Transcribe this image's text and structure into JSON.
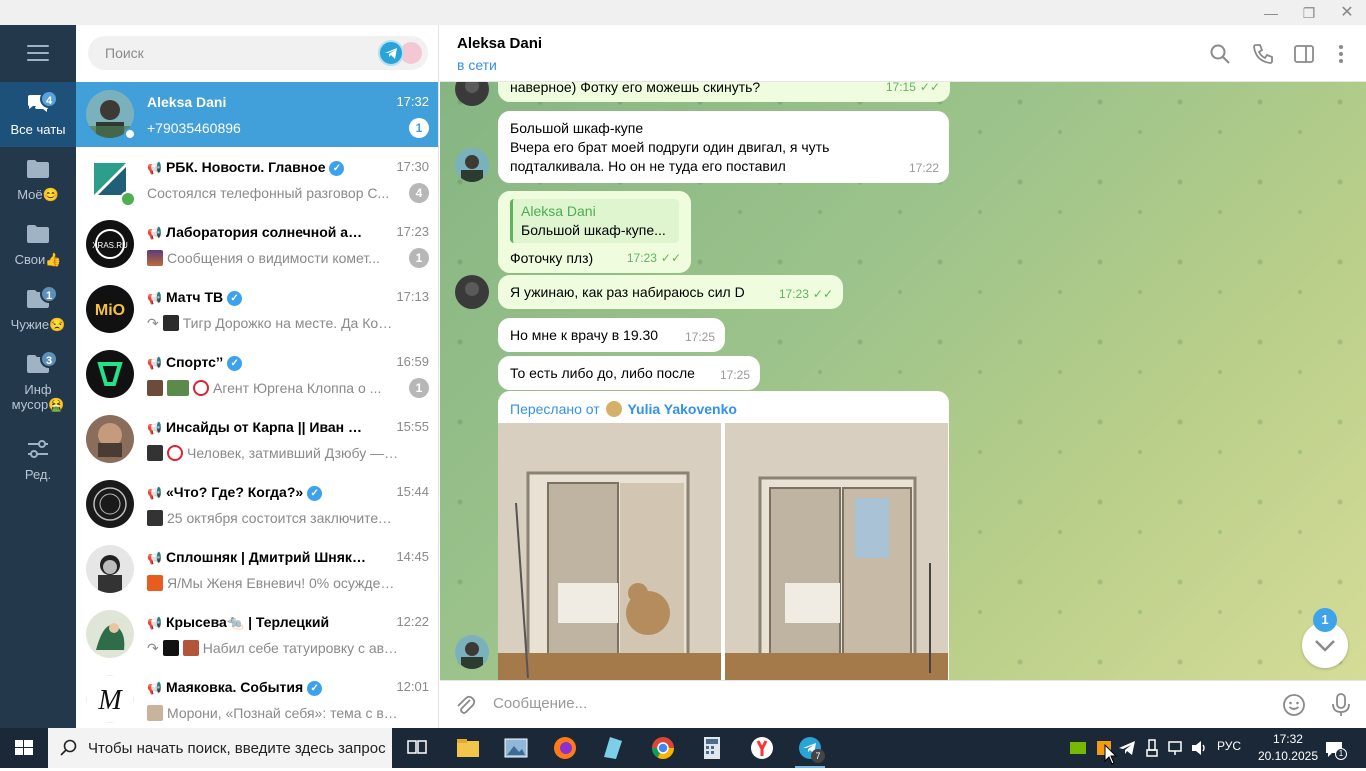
{
  "rail": {
    "folders": [
      {
        "label": "Все чаты",
        "badge": "4"
      },
      {
        "label": "Моё😊",
        "badge": ""
      },
      {
        "label": "Свои👍",
        "badge": ""
      },
      {
        "label": "Чужие😒",
        "badge": "1"
      },
      {
        "label": "Инф мусор🤮",
        "badge": "3"
      },
      {
        "label": "Ред.",
        "badge": ""
      }
    ]
  },
  "search": {
    "placeholder": "Поиск"
  },
  "chats": [
    {
      "name": "Aleksa Dani",
      "time": "17:32",
      "preview": "+79035460896",
      "badge": "1"
    },
    {
      "name": "РБК. Новости. Главное",
      "time": "17:30",
      "preview": "Состоялся телефонный разговор С...",
      "badge": "4"
    },
    {
      "name": "Лаборатория солнечной аст...",
      "time": "17:23",
      "preview": "Сообщения о видимости комет...",
      "badge": "1"
    },
    {
      "name": "Матч ТВ",
      "time": "17:13",
      "preview": "Тигр Дорожко на месте. Да Кост...",
      "badge": ""
    },
    {
      "name": "Спортс’’",
      "time": "16:59",
      "preview": "Агент Юргена Клоппа о ...",
      "badge": "1"
    },
    {
      "name": "Инсайды от Карпа || Иван К...",
      "time": "15:55",
      "preview": "Человек, затмивший Дзюбу — в...",
      "badge": ""
    },
    {
      "name": "«Что? Где? Когда?»",
      "time": "15:44",
      "preview": "25 октября состоится заключитель...",
      "badge": ""
    },
    {
      "name": "Сплошняк | Дмитрий Шнякин",
      "time": "14:45",
      "preview": "Я/Мы Женя Евневич! 0% осуждения...",
      "badge": ""
    },
    {
      "name": "Крысева🐀 | Терлецкий",
      "time": "12:22",
      "preview": "Набил себе татуировку с авт...",
      "badge": ""
    },
    {
      "name": "Маяковка. События",
      "time": "12:01",
      "preview": "Морони, «Познай себя»: тема с вар...",
      "badge": ""
    }
  ],
  "conversation": {
    "title": "Aleksa Dani",
    "status": "в сети",
    "messages": {
      "m1": {
        "text": "наверное) Фотку его можешь скинуть?",
        "time": "17:15"
      },
      "m2": {
        "line1": "Большой шкаф-купе",
        "line2": "Вчера его брат моей подруги один двигал, я чуть",
        "line3": "подталкивала. Но он не туда его поставил",
        "time": "17:22"
      },
      "m3": {
        "reply_name": "Aleksa Dani",
        "reply_text": "Большой шкаф-купе...",
        "text": "Фоточку плз)",
        "time": "17:23"
      },
      "m4": {
        "text": "Я ужинаю, как раз набираюсь сил D",
        "time": "17:23"
      },
      "m5": {
        "text": "Но мне к врачу в 19.30",
        "time": "17:25"
      },
      "m6": {
        "text": "То есть либо до, либо после",
        "time": "17:25"
      },
      "m7": {
        "fwd_prefix": "Переслано от",
        "fwd_name": "Yulia Yakovenko"
      }
    },
    "unread_scroll_badge": "1",
    "composer_placeholder": "Сообщение..."
  },
  "taskbar": {
    "search_text": "Чтобы начать поиск, введите здесь запрос",
    "lang": "РУС",
    "time": "17:32",
    "date": "20.10.2025",
    "telegram_badge": "7",
    "notif_badge": "1"
  }
}
